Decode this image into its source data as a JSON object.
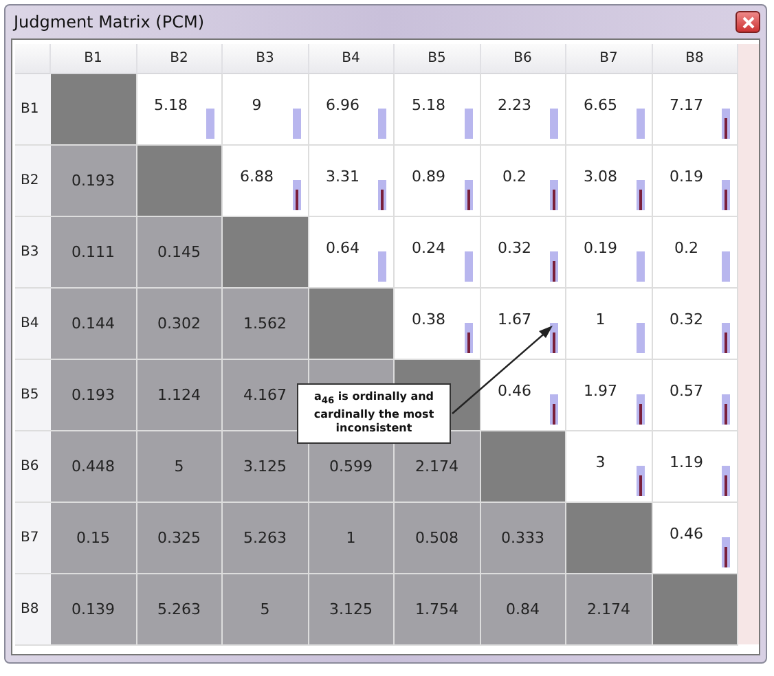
{
  "window": {
    "title": "Judgment Matrix (PCM)"
  },
  "columns": [
    "B1",
    "B2",
    "B3",
    "B4",
    "B5",
    "B6",
    "B7",
    "B8"
  ],
  "rows": [
    {
      "label": "B1",
      "cells": [
        {
          "kind": "diagonal"
        },
        {
          "kind": "upper",
          "text": "5.18",
          "flagged": false
        },
        {
          "kind": "upper",
          "text": "9",
          "flagged": false
        },
        {
          "kind": "upper",
          "text": "6.96",
          "flagged": false
        },
        {
          "kind": "upper",
          "text": "5.18",
          "flagged": false
        },
        {
          "kind": "upper",
          "text": "2.23",
          "flagged": false
        },
        {
          "kind": "upper",
          "text": "6.65",
          "flagged": false
        },
        {
          "kind": "upper",
          "text": "7.17",
          "flagged": true
        }
      ]
    },
    {
      "label": "B2",
      "cells": [
        {
          "kind": "lower",
          "text": "0.193"
        },
        {
          "kind": "diagonal"
        },
        {
          "kind": "upper",
          "text": "6.88",
          "flagged": true
        },
        {
          "kind": "upper",
          "text": "3.31",
          "flagged": true
        },
        {
          "kind": "upper",
          "text": "0.89",
          "flagged": true
        },
        {
          "kind": "upper",
          "text": "0.2",
          "flagged": true
        },
        {
          "kind": "upper",
          "text": "3.08",
          "flagged": true
        },
        {
          "kind": "upper",
          "text": "0.19",
          "flagged": true
        }
      ]
    },
    {
      "label": "B3",
      "cells": [
        {
          "kind": "lower",
          "text": "0.111"
        },
        {
          "kind": "lower",
          "text": "0.145"
        },
        {
          "kind": "diagonal"
        },
        {
          "kind": "upper",
          "text": "0.64",
          "flagged": false
        },
        {
          "kind": "upper",
          "text": "0.24",
          "flagged": false
        },
        {
          "kind": "upper",
          "text": "0.32",
          "flagged": true
        },
        {
          "kind": "upper",
          "text": "0.19",
          "flagged": false
        },
        {
          "kind": "upper",
          "text": "0.2",
          "flagged": false
        }
      ]
    },
    {
      "label": "B4",
      "cells": [
        {
          "kind": "lower",
          "text": "0.144"
        },
        {
          "kind": "lower",
          "text": "0.302"
        },
        {
          "kind": "lower",
          "text": "1.562"
        },
        {
          "kind": "diagonal"
        },
        {
          "kind": "upper",
          "text": "0.38",
          "flagged": true
        },
        {
          "kind": "upper",
          "text": "1.67",
          "flagged": true
        },
        {
          "kind": "upper",
          "text": "1",
          "flagged": false
        },
        {
          "kind": "upper",
          "text": "0.32",
          "flagged": true
        }
      ]
    },
    {
      "label": "B5",
      "cells": [
        {
          "kind": "lower",
          "text": "0.193"
        },
        {
          "kind": "lower",
          "text": "1.124"
        },
        {
          "kind": "lower",
          "text": "4.167"
        },
        {
          "kind": "lower"
        },
        {
          "kind": "diagonal"
        },
        {
          "kind": "upper",
          "text": "0.46",
          "flagged": true
        },
        {
          "kind": "upper",
          "text": "1.97",
          "flagged": true
        },
        {
          "kind": "upper",
          "text": "0.57",
          "flagged": true
        }
      ]
    },
    {
      "label": "B6",
      "cells": [
        {
          "kind": "lower",
          "text": "0.448"
        },
        {
          "kind": "lower",
          "text": "5"
        },
        {
          "kind": "lower",
          "text": "3.125"
        },
        {
          "kind": "lower",
          "text": "0.599"
        },
        {
          "kind": "lower",
          "text": "2.174"
        },
        {
          "kind": "diagonal"
        },
        {
          "kind": "upper",
          "text": "3",
          "flagged": true
        },
        {
          "kind": "upper",
          "text": "1.19",
          "flagged": true
        }
      ]
    },
    {
      "label": "B7",
      "cells": [
        {
          "kind": "lower",
          "text": "0.15"
        },
        {
          "kind": "lower",
          "text": "0.325"
        },
        {
          "kind": "lower",
          "text": "5.263"
        },
        {
          "kind": "lower",
          "text": "1"
        },
        {
          "kind": "lower",
          "text": "0.508"
        },
        {
          "kind": "lower",
          "text": "0.333"
        },
        {
          "kind": "diagonal"
        },
        {
          "kind": "upper",
          "text": "0.46",
          "flagged": true
        }
      ]
    },
    {
      "label": "B8",
      "cells": [
        {
          "kind": "lower",
          "text": "0.139"
        },
        {
          "kind": "lower",
          "text": "5.263"
        },
        {
          "kind": "lower",
          "text": "5"
        },
        {
          "kind": "lower",
          "text": "3.125"
        },
        {
          "kind": "lower",
          "text": "1.754"
        },
        {
          "kind": "lower",
          "text": "0.84"
        },
        {
          "kind": "lower",
          "text": "2.174"
        },
        {
          "kind": "diagonal"
        }
      ]
    }
  ],
  "callout": {
    "text": "a$_{46}$ is ordinally and cardinally the most inconsistent"
  }
}
